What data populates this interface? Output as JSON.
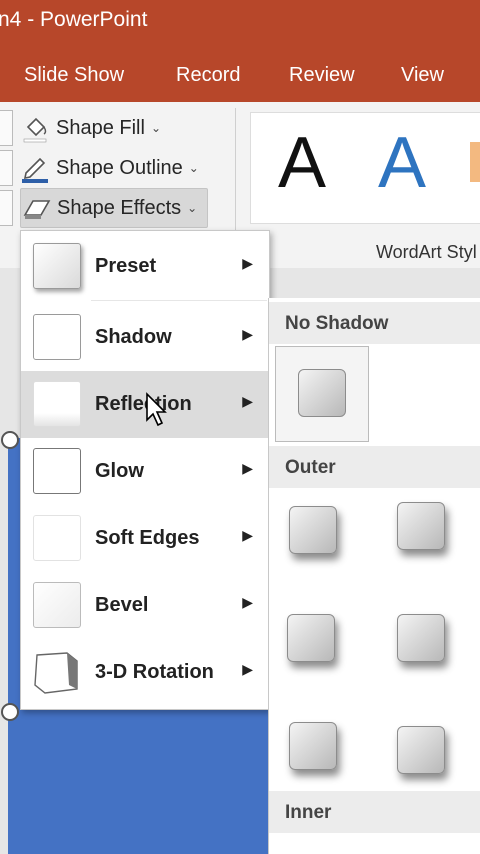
{
  "window": {
    "title": "n4  -  PowerPoint"
  },
  "tabs": [
    "Slide Show",
    "Record",
    "Review",
    "View"
  ],
  "ribbon": {
    "shape_fill": "Shape Fill",
    "shape_outline": "Shape Outline",
    "shape_effects": "Shape Effects",
    "wordart_sample_black": "A",
    "wordart_sample_blue": "A",
    "wordart_group_label": "WordArt Styl"
  },
  "effects_menu": {
    "items": [
      {
        "label": "Preset"
      },
      {
        "label": "Shadow"
      },
      {
        "label": "Reflection"
      },
      {
        "label": "Glow"
      },
      {
        "label": "Soft Edges"
      },
      {
        "label": "Bevel"
      },
      {
        "label": "3-D Rotation"
      }
    ],
    "hovered_index": 2
  },
  "shadow_submenu": {
    "no_shadow_header": "No Shadow",
    "outer_header": "Outer",
    "inner_header": "Inner"
  },
  "colors": {
    "accent": "#b7472a",
    "slide_blue": "#4472c4",
    "wordart_blue": "#2e74c0"
  }
}
